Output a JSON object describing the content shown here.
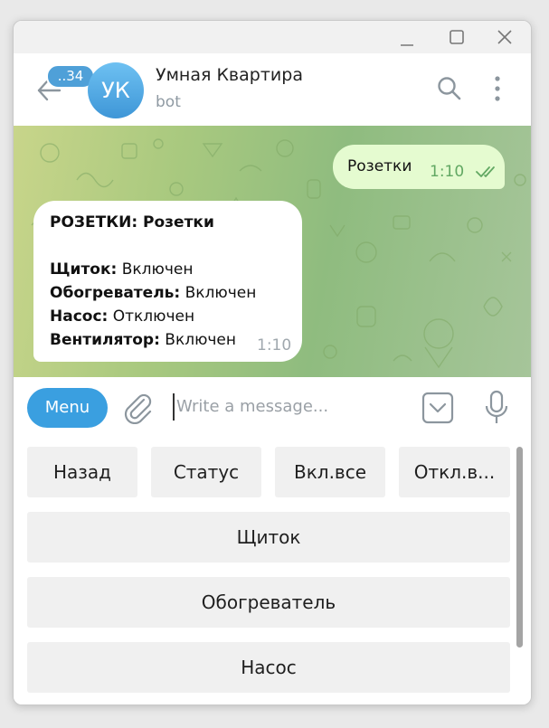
{
  "chat": {
    "title": "Умная Квартира",
    "subtitle": "bot",
    "avatar_initials": "УК",
    "unread_badge": "..34"
  },
  "messages": {
    "outgoing": {
      "text": "Розетки",
      "time": "1:10"
    },
    "incoming": {
      "heading": "РОЗЕТКИ: Розетки",
      "lines": [
        {
          "label": "Щиток:",
          "value": " Включен"
        },
        {
          "label": "Обогреватель:",
          "value": " Включен"
        },
        {
          "label": "Насос:",
          "value": " Отключен"
        },
        {
          "label": "Вентилятор:",
          "value": " Включен"
        }
      ],
      "time": "1:10"
    }
  },
  "composer": {
    "menu_label": "Menu",
    "placeholder": "Write a message..."
  },
  "keyboard": {
    "row1": [
      "Назад",
      "Статус",
      "Вкл.все",
      "Откл.в..."
    ],
    "rows": [
      "Щиток",
      "Обогреватель",
      "Насос"
    ]
  },
  "colors": {
    "accent": "#3a9fe0",
    "outgoing_bubble": "#e5fbd0",
    "read_checks": "#62a863",
    "chat_bg": "#a9c97f"
  },
  "icons": [
    "back-arrow-icon",
    "search-icon",
    "more-vertical-icon",
    "attach-icon",
    "bot-commands-icon",
    "microphone-icon",
    "double-check-icon",
    "minimize-icon",
    "maximize-icon",
    "close-icon"
  ]
}
